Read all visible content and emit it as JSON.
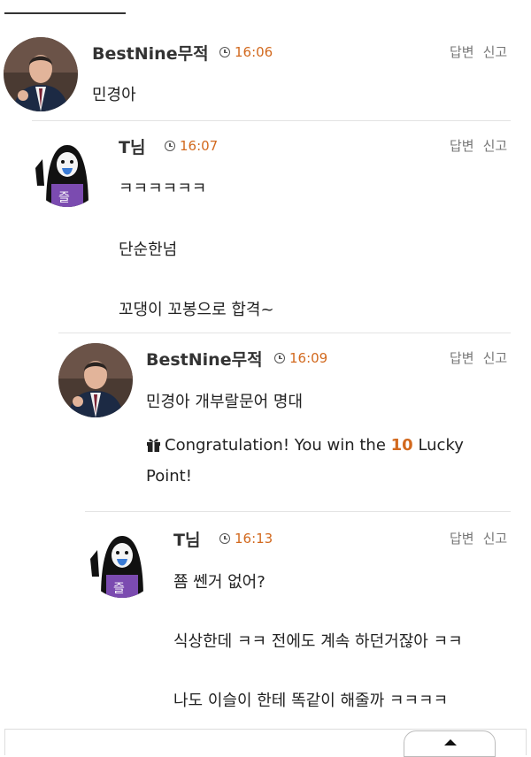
{
  "comments": [
    {
      "author": "BestNine무적",
      "time": "16:06",
      "reply_label": "답변",
      "report_label": "신고",
      "lines": [
        "민경아"
      ]
    },
    {
      "author": "T님",
      "time": "16:07",
      "reply_label": "답변",
      "report_label": "신고",
      "lines": [
        "ㅋㅋㅋㅋㅋㅋ",
        "단순한넘",
        "꼬댕이 꼬봉으로 합격~"
      ]
    },
    {
      "author": "BestNine무적",
      "time": "16:09",
      "reply_label": "답변",
      "report_label": "신고",
      "lines": [
        "민경아 개부랄문어 명대"
      ],
      "lucky": {
        "prefix": "Congratulation! You win the",
        "points": "10",
        "suffix": "Lucky Point!"
      }
    },
    {
      "author": "T님",
      "time": "16:13",
      "reply_label": "답변",
      "report_label": "신고",
      "lines": [
        "쬼 쎈거 없어?",
        "식상한데 ㅋㅋ 전에도 계속 하던거잖아 ㅋㅋ",
        "나도 이슬이 한테 똑같이 해줄까 ㅋㅋㅋㅋ"
      ]
    }
  ],
  "icons": {
    "clock": "clock-icon",
    "gift": "gift-icon",
    "scroll_top": "chevron-up-icon"
  },
  "colors": {
    "time": "#d2691e",
    "points": "#d2691e"
  }
}
